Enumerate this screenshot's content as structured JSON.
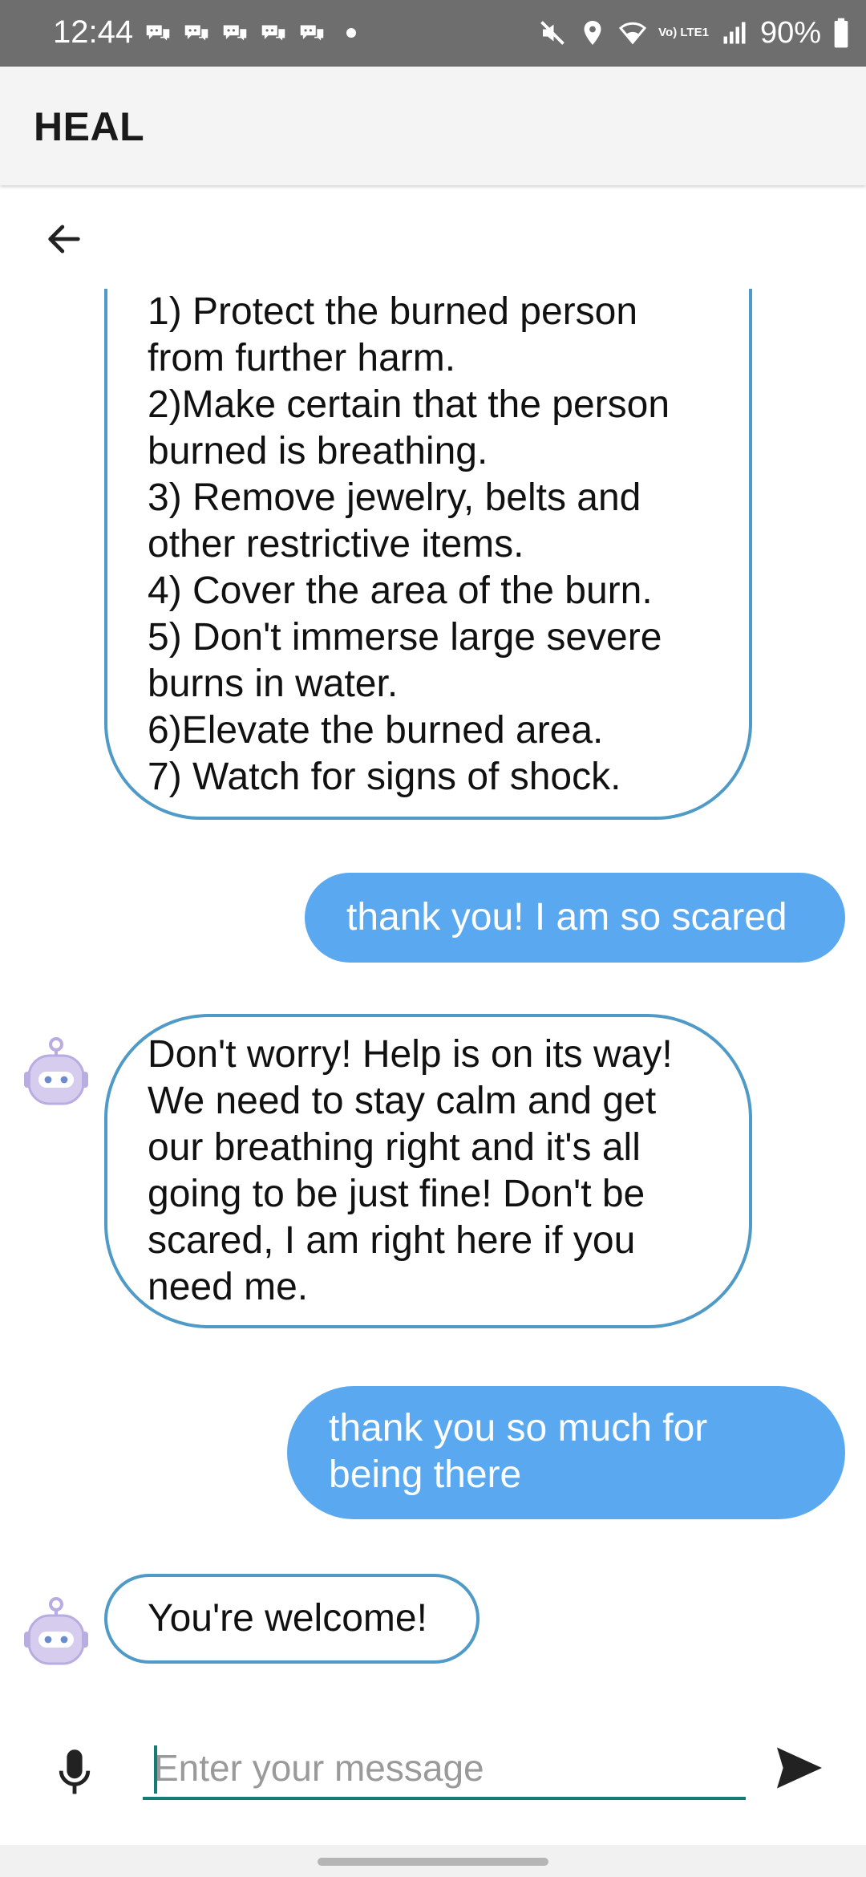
{
  "status_bar": {
    "time": "12:44",
    "battery_text": "90%",
    "volte_text": "Vo) LTE1",
    "notification_icons": [
      "chat-notification-icon",
      "chat-notification-icon",
      "chat-notification-icon",
      "chat-notification-icon",
      "chat-notification-icon"
    ],
    "right_icons": [
      "mute-icon",
      "location-icon",
      "wifi-icon",
      "signal-icon",
      "battery-icon"
    ]
  },
  "app_bar": {
    "title": "HEAL"
  },
  "navigation": {
    "back_icon": "arrow-left-icon"
  },
  "messages": [
    {
      "sender": "bot",
      "lines": [
        "1) Protect the burned person",
        "from further harm.",
        "2)Make certain that the person",
        "burned is breathing.",
        "3) Remove jewelry, belts and",
        "other restrictive items.",
        "4) Cover the area of the burn.",
        "5) Don't immerse large severe",
        "burns in water.",
        "6)Elevate the burned area.",
        "7) Watch for signs of shock."
      ]
    },
    {
      "sender": "user",
      "text": "thank you! I am so scared"
    },
    {
      "sender": "bot",
      "text": "Don't worry! Help is on its way! We need to stay calm and get our breathing right and it's all going to be just fine! Don't be scared, I am right here if you need me."
    },
    {
      "sender": "user",
      "text": "thank you so much for being there"
    },
    {
      "sender": "bot",
      "text": "You're welcome!"
    }
  ],
  "input": {
    "placeholder": "Enter your message",
    "value": "",
    "mic_icon": "microphone-icon",
    "send_icon": "send-icon"
  },
  "colors": {
    "status_bar": "#6e6e6e",
    "app_bar": "#f4f4f4",
    "bot_bubble_border": "#4f9ac6",
    "user_bubble": "#5aa9f0",
    "input_underline": "#177a74",
    "avatar": "#c9bfe6"
  }
}
